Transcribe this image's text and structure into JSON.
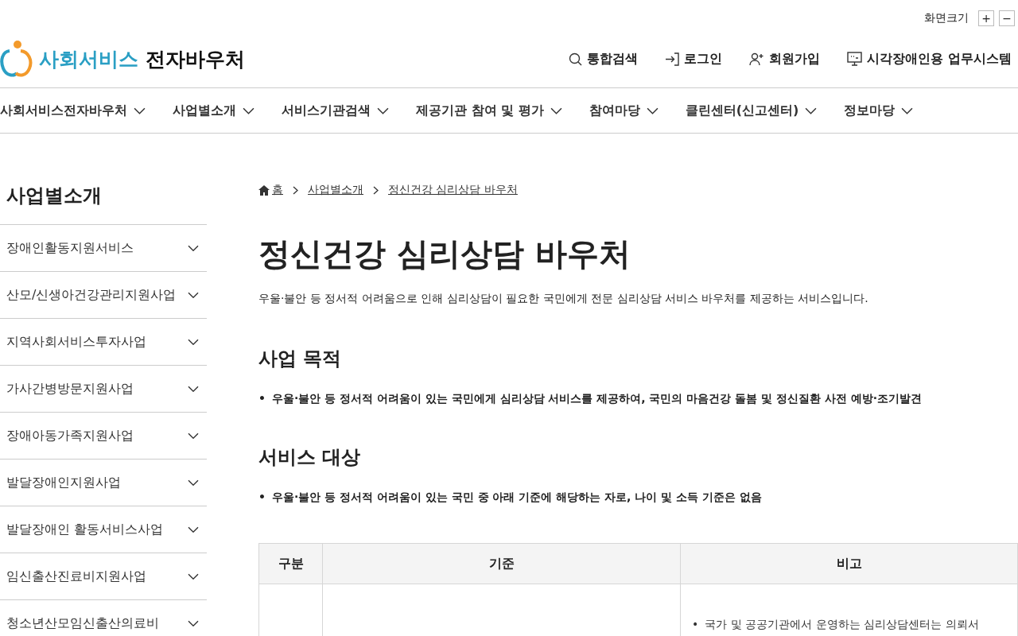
{
  "utility": {
    "label": "화면크기",
    "zoom_in": "+",
    "zoom_out": "−"
  },
  "logo": {
    "accent": "사회서비스",
    "rest": "전자바우처"
  },
  "top_links": [
    {
      "kind": "search",
      "label": "통합검색"
    },
    {
      "kind": "login",
      "label": "로그인"
    },
    {
      "kind": "join",
      "label": "회원가입"
    },
    {
      "kind": "monitor",
      "label": "시각장애인용 업무시스템"
    }
  ],
  "nav": [
    "사회서비스전자바우처",
    "사업별소개",
    "서비스기관검색",
    "제공기관 참여 및 평가",
    "참여마당",
    "클린센터(신고센터)",
    "정보마당"
  ],
  "sidebar": {
    "title": "사업별소개",
    "items": [
      {
        "label": "장애인활동지원서비스",
        "expanded": false
      },
      {
        "label": "산모/신생아건강관리지원사업",
        "expanded": false
      },
      {
        "label": "지역사회서비스투자사업",
        "expanded": false
      },
      {
        "label": "가사간병방문지원사업",
        "expanded": false
      },
      {
        "label": "장애아동가족지원사업",
        "expanded": false
      },
      {
        "label": "발달장애인지원사업",
        "expanded": false
      },
      {
        "label": "발달장애인 활동서비스사업",
        "expanded": false
      },
      {
        "label": "임신출산진료비지원사업",
        "expanded": false
      },
      {
        "label": "청소년산모임신출산의료비",
        "expanded": false
      }
    ]
  },
  "breadcrumb": [
    "홈",
    "사업별소개",
    "정신건강 심리상담 바우처"
  ],
  "title": "정신건강 심리상담 바우처",
  "intro": "우울·불안 등 정서적 어려움으로 인해 심리상담이 필요한 국민에게 전문 심리상담 서비스 바우처를 제공하는 서비스입니다.",
  "sections": [
    {
      "heading": "사업 목적",
      "bullets": [
        {
          "marker": "•",
          "text": "우울·불안 등 정서적 어려움이 있는 국민에게 심리상담 서비스를 제공하여, 국민의 마음건강 돌봄 및 정신질환 사전 예방·조기발견"
        }
      ]
    },
    {
      "heading": "서비스 대상",
      "bullets": [
        {
          "marker": "•",
          "text": "우울·불안 등 정서적 어려움이 있는 국민 중 아래 기준에 해당하는 자로, 나이 및 소득 기준은 없음"
        }
      ]
    }
  ],
  "table": {
    "columns": [
      "구분",
      "기준",
      "비고"
    ],
    "rows": [
      {
        "column_3": [
          {
            "marker": "•",
            "text": "국가 및 공공기관에서 운영하는 심리상담센터는 의뢰서"
          }
        ]
      }
    ]
  }
}
